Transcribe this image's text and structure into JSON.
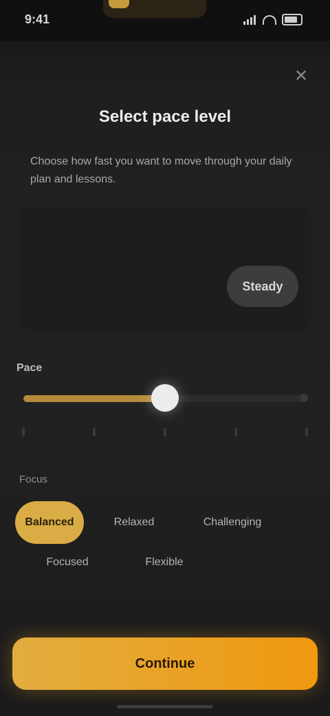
{
  "status_bar": {
    "time": "9:41",
    "icons": [
      "signal-icon",
      "wifi-icon",
      "battery-icon"
    ]
  },
  "header": {
    "close_icon": "close-icon",
    "title": "Select pace level",
    "description": "Choose how fast you want to move through your daily plan and lessons."
  },
  "preview": {
    "pill_label": "Steady"
  },
  "slider": {
    "label": "Pace",
    "value_fraction": 0.5,
    "tick_count": 5
  },
  "options": {
    "label": "Focus",
    "chips": [
      {
        "label": "Balanced",
        "selected": true
      },
      {
        "label": "Relaxed",
        "selected": false
      },
      {
        "label": "Challenging",
        "selected": false
      },
      {
        "label": "Focused",
        "selected": false
      },
      {
        "label": "Flexible",
        "selected": false
      }
    ]
  },
  "cta": {
    "label": "Continue"
  },
  "colors": {
    "accent": "#d9ac45",
    "cta_start": "#e2ad3f",
    "cta_end": "#f09910",
    "background": "#1f1f1f"
  }
}
